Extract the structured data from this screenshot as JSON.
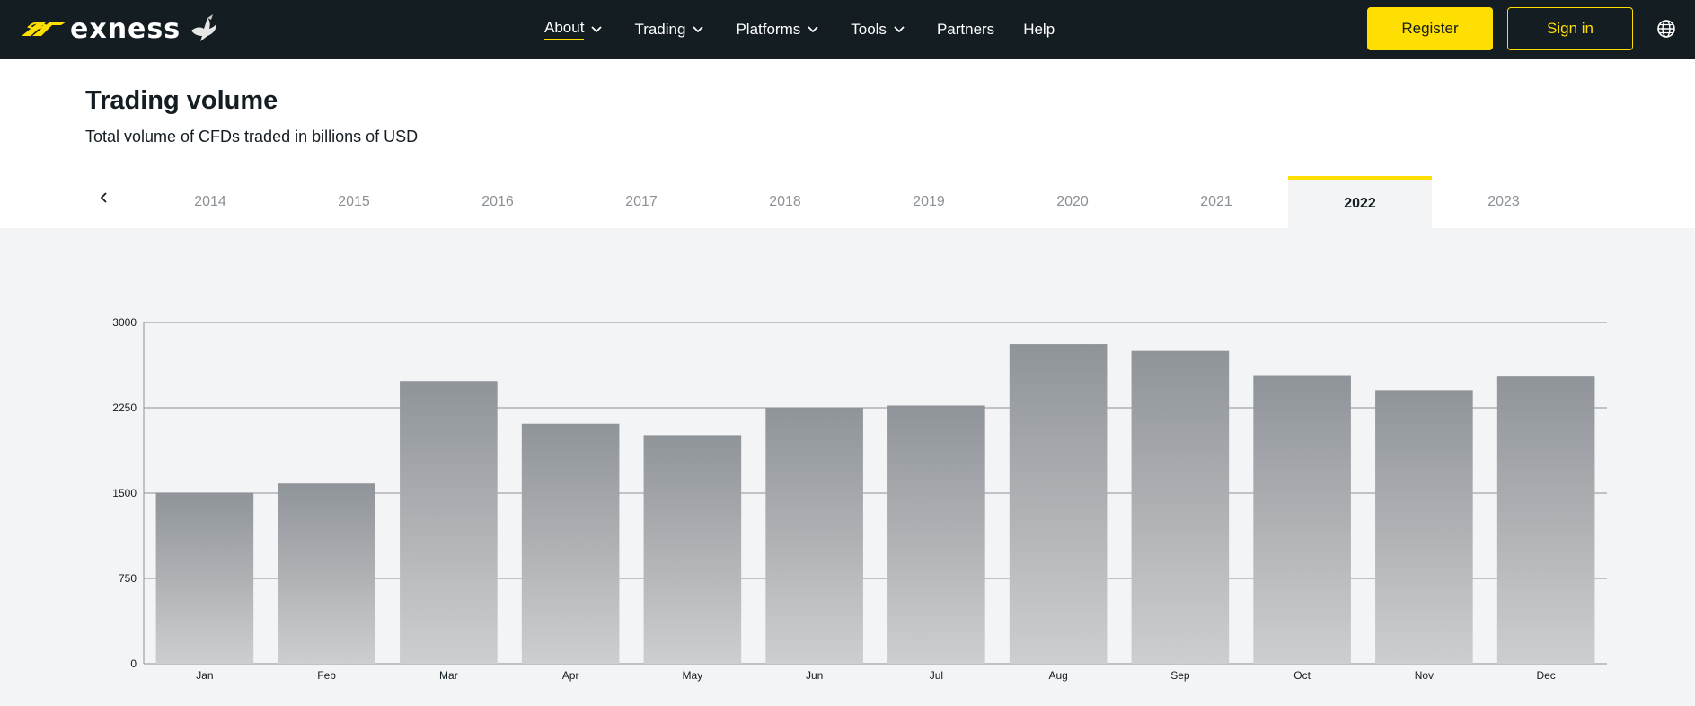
{
  "header": {
    "logo_text": "exness",
    "nav": [
      {
        "label": "About",
        "has_dropdown": true,
        "active": true
      },
      {
        "label": "Trading",
        "has_dropdown": true
      },
      {
        "label": "Platforms",
        "has_dropdown": true
      },
      {
        "label": "Tools",
        "has_dropdown": true
      },
      {
        "label": "Partners",
        "has_dropdown": false
      },
      {
        "label": "Help",
        "has_dropdown": false
      }
    ],
    "register_label": "Register",
    "signin_label": "Sign in",
    "language_icon": "globe-icon"
  },
  "section": {
    "title": "Trading volume",
    "subtitle": "Total volume of CFDs traded in billions of USD"
  },
  "year_tabs": {
    "years": [
      "2014",
      "2015",
      "2016",
      "2017",
      "2018",
      "2019",
      "2020",
      "2021",
      "2022",
      "2023"
    ],
    "selected": "2022"
  },
  "colors": {
    "brand_yellow": "#ffde02",
    "topbar": "#141d22",
    "bar_top": "#8f9499",
    "bar_bottom": "#cdcecf",
    "grid": "#8c9196"
  },
  "chart_data": {
    "type": "bar",
    "categories": [
      "Jan",
      "Feb",
      "Mar",
      "Apr",
      "May",
      "Jun",
      "Jul",
      "Aug",
      "Sep",
      "Oct",
      "Nov",
      "Dec"
    ],
    "values": [
      1505,
      1585,
      2485,
      2110,
      2010,
      2250,
      2270,
      2810,
      2750,
      2530,
      2405,
      2525
    ],
    "ylim": [
      0,
      3000
    ],
    "yticks": [
      "0",
      "750",
      "1500",
      "2250",
      "3000"
    ],
    "grid": true
  }
}
